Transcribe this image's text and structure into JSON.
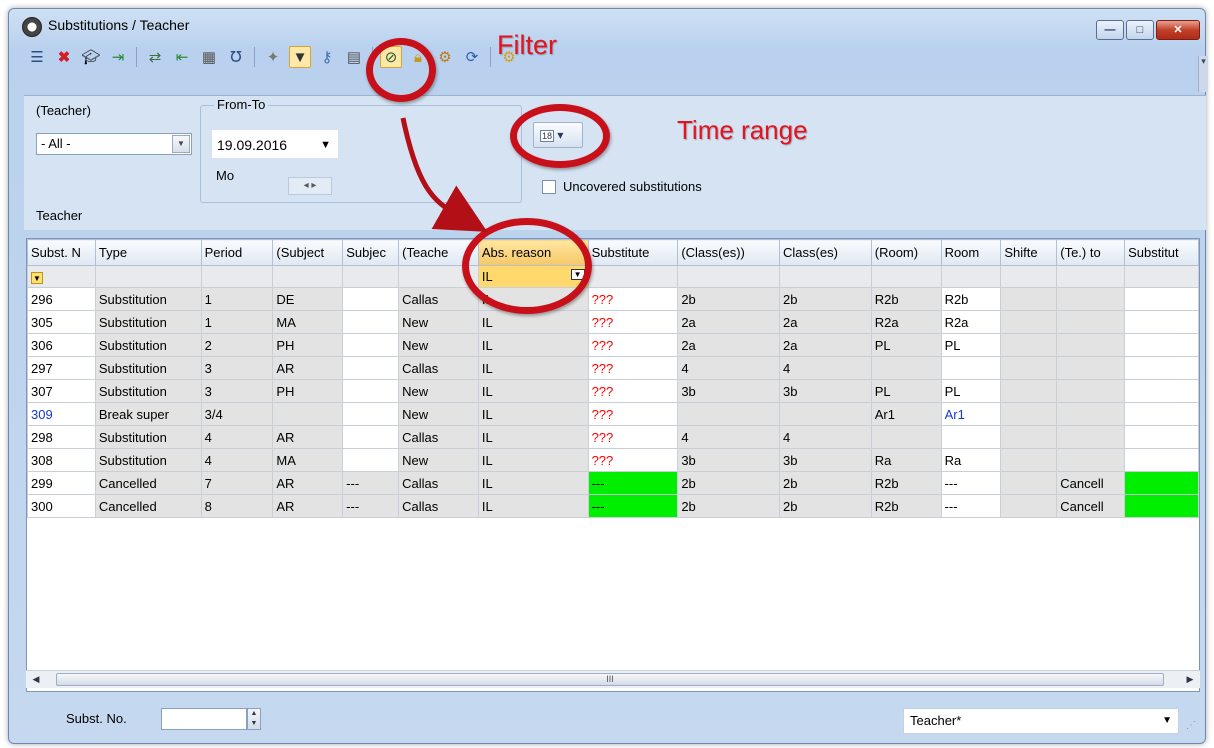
{
  "window": {
    "title": "Substitutions / Teacher",
    "buttons": [
      "—",
      "□",
      "✕"
    ]
  },
  "toolbar": {
    "icons": [
      "list-icon",
      "delete-icon",
      "mortarboard-icon",
      "export-icon",
      "swap-icon",
      "import-icon",
      "calculator-icon",
      "stethoscope-icon",
      "magic-wand-icon",
      "filter-icon",
      "key-icon",
      "table-icon",
      "compare-icon",
      "lock-icon",
      "settings-icon",
      "refresh-icon",
      "gear-icon"
    ]
  },
  "annotations": {
    "filter_label": "Filter",
    "time_range_label": "Time range"
  },
  "filters": {
    "teacher_label": "(Teacher)",
    "teacher_value": "- All -",
    "fromto_label": "From-To",
    "date_value": "19.09.2016",
    "weekday": "Mo",
    "uncovered_label": "Uncovered substitutions",
    "section_label": "Teacher",
    "calendar_glyph": "18"
  },
  "grid": {
    "columns": [
      "Subst. N",
      "Type",
      "Period",
      "(Subject",
      "Subjec",
      "(Teache",
      "Abs. reason",
      "Substitute",
      "(Class(es))",
      "Class(es)",
      "(Room)",
      "Room",
      "Shifte",
      "(Te.) to",
      "Substitut"
    ],
    "filter_value": "IL",
    "rows": [
      [
        "296",
        "Substitution",
        "1",
        "DE",
        "",
        "Callas",
        "IL",
        "???",
        "2b",
        "2b",
        "R2b",
        "R2b",
        "",
        "",
        ""
      ],
      [
        "305",
        "Substitution",
        "1",
        "MA",
        "",
        "New",
        "IL",
        "???",
        "2a",
        "2a",
        "R2a",
        "R2a",
        "",
        "",
        ""
      ],
      [
        "306",
        "Substitution",
        "2",
        "PH",
        "",
        "New",
        "IL",
        "???",
        "2a",
        "2a",
        "PL",
        "PL",
        "",
        "",
        ""
      ],
      [
        "297",
        "Substitution",
        "3",
        "AR",
        "",
        "Callas",
        "IL",
        "???",
        "4",
        "4",
        "",
        "",
        "",
        "",
        ""
      ],
      [
        "307",
        "Substitution",
        "3",
        "PH",
        "",
        "New",
        "IL",
        "???",
        "3b",
        "3b",
        "PL",
        "PL",
        "",
        "",
        ""
      ],
      [
        "309",
        "Break super",
        "3/4",
        "",
        "",
        "New",
        "IL",
        "???",
        "",
        "",
        "Ar1",
        "Ar1",
        "",
        "",
        ""
      ],
      [
        "298",
        "Substitution",
        "4",
        "AR",
        "",
        "Callas",
        "IL",
        "???",
        "4",
        "4",
        "",
        "",
        "",
        "",
        ""
      ],
      [
        "308",
        "Substitution",
        "4",
        "MA",
        "",
        "New",
        "IL",
        "???",
        "3b",
        "3b",
        "Ra",
        "Ra",
        "",
        "",
        ""
      ],
      [
        "299",
        "Cancelled",
        "7",
        "AR",
        "---",
        "Callas",
        "IL",
        "---",
        "2b",
        "2b",
        "R2b",
        "---",
        "",
        "Cancell",
        ""
      ],
      [
        "300",
        "Cancelled",
        "8",
        "AR",
        "---",
        "Callas",
        "IL",
        "---",
        "2b",
        "2b",
        "R2b",
        "---",
        "",
        "Cancell",
        ""
      ]
    ]
  },
  "status": {
    "subst_label": "Subst. No.",
    "subst_value": "",
    "view_value": "Teacher*"
  },
  "colors": {
    "red_annotation": "#e4131d",
    "highlight_green": "#00ef00",
    "missing_red": "#ff0000",
    "link_blue": "#1538d6"
  }
}
